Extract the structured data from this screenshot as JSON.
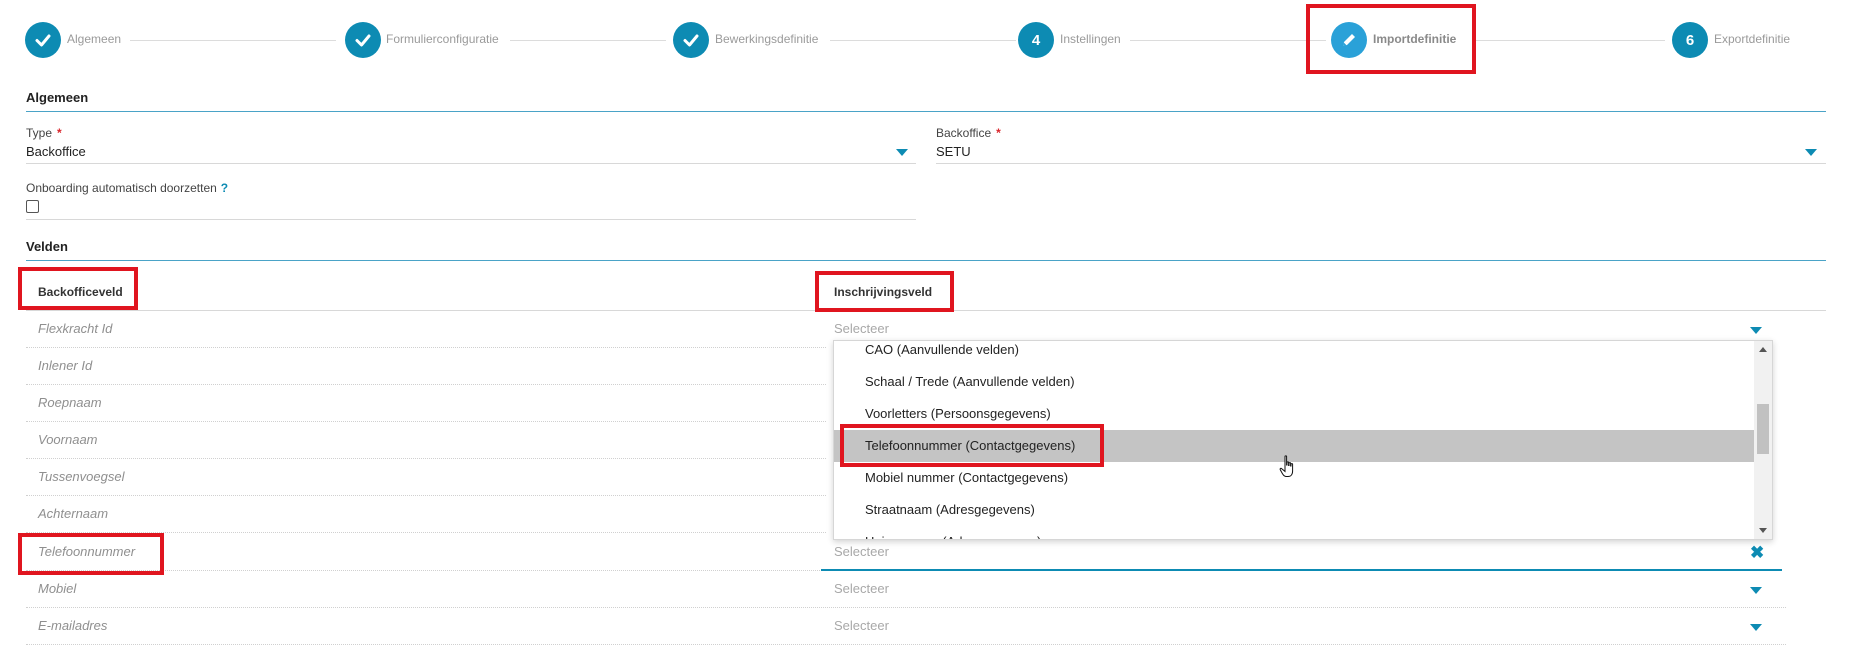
{
  "steps": [
    {
      "label": "Algemeen",
      "state": "done"
    },
    {
      "label": "Formulierconfiguratie",
      "state": "done"
    },
    {
      "label": "Bewerkingsdefinitie",
      "state": "done"
    },
    {
      "label": "Instellingen",
      "number": "4"
    },
    {
      "label": "Importdefinitie",
      "state": "active",
      "icon": "pencil-icon"
    },
    {
      "label": "Exportdefinitie",
      "number": "6"
    }
  ],
  "general": {
    "title": "Algemeen",
    "type_label": "Type",
    "type_value": "Backoffice",
    "backoffice_label": "Backoffice",
    "backoffice_value": "SETU",
    "required_mark": "*",
    "onboarding_label": "Onboarding automatisch doorzetten",
    "onboarding_help": "?"
  },
  "fields": {
    "title": "Velden",
    "col_backoffice": "Backofficeveld",
    "col_inschrijving": "Inschrijvingsveld",
    "placeholder": "Selecteer",
    "rows": [
      "Flexkracht Id",
      "Inlener Id",
      "Roepnaam",
      "Voornaam",
      "Tussenvoegsel",
      "Achternaam",
      "Telefoonnummer",
      "Mobiel",
      "E-mailadres"
    ]
  },
  "dropdown": {
    "options": [
      "CAO (Aanvullende velden)",
      "Schaal / Trede (Aanvullende velden)",
      "Voorletters (Persoonsgegevens)",
      "Telefoonnummer (Contactgegevens)",
      "Mobiel nummer (Contactgegevens)",
      "Straatnaam (Adresgegevens)",
      "Huisnummer (Adresgegevens)"
    ],
    "highlighted_index": 3
  },
  "colors": {
    "accent": "#0d8bb3",
    "active_step": "#2aa1d8",
    "annotation": "#e0151f"
  }
}
